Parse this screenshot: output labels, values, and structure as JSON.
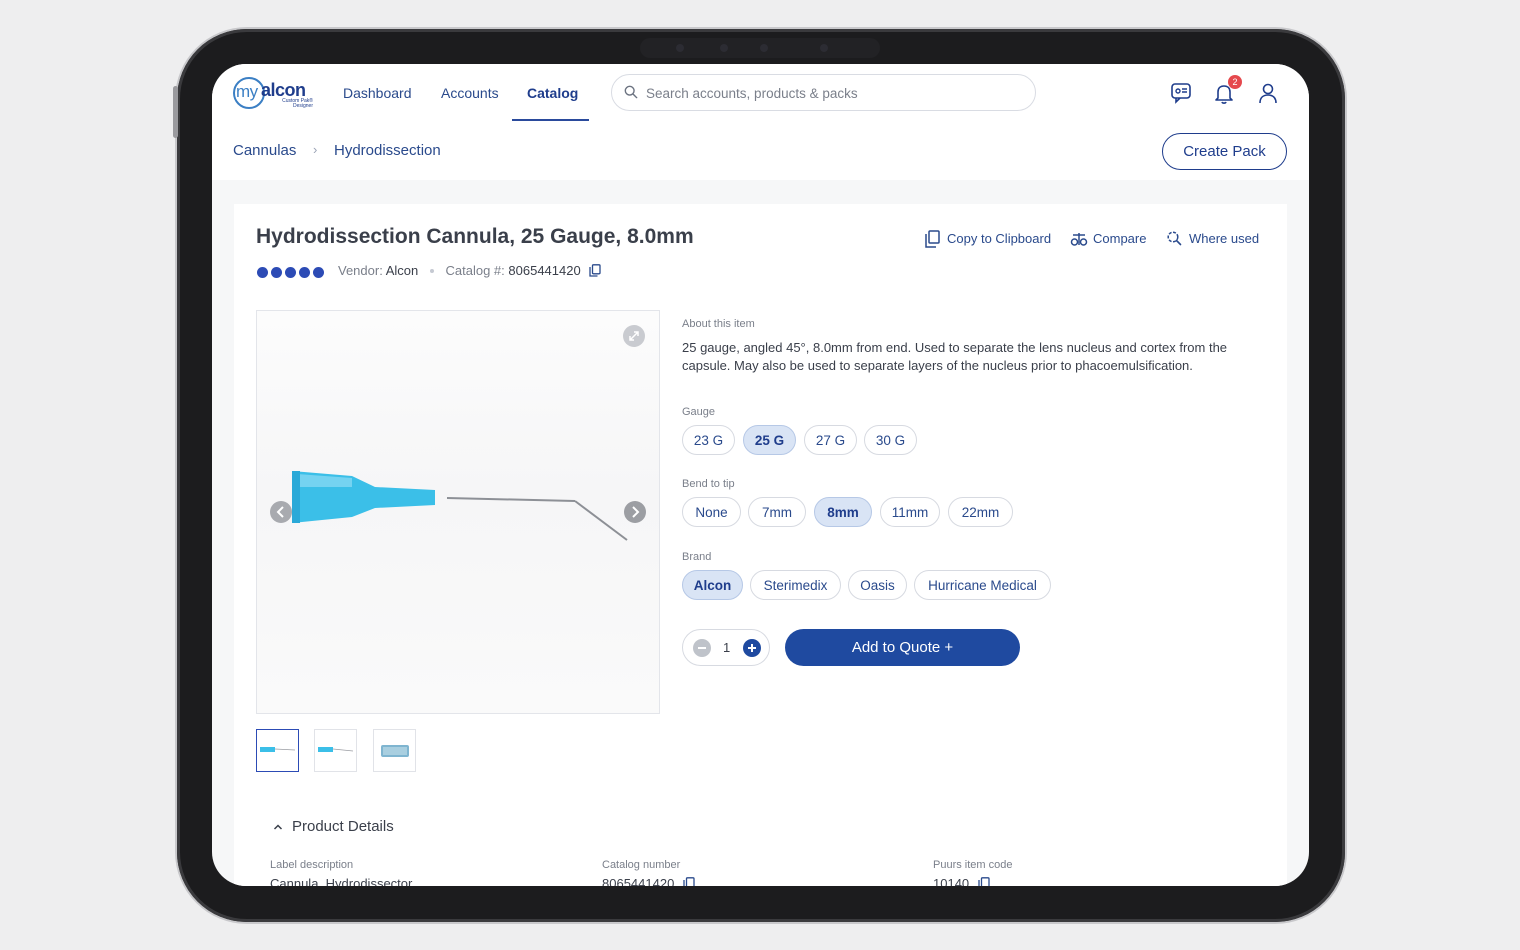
{
  "nav": {
    "logo_my": "my",
    "logo_alcon": "alcon",
    "logo_sub": "Custom Pak® Designer",
    "items": [
      "Dashboard",
      "Accounts",
      "Catalog"
    ],
    "active": "Catalog",
    "search_placeholder": "Search accounts, products & packs",
    "notification_count": "2"
  },
  "breadcrumb": [
    "Cannulas",
    "Hydrodissection"
  ],
  "breadcrumb_separator": "›",
  "create_pack_label": "Create Pack",
  "product": {
    "title": "Hydrodissection Cannula, 25 Gauge, 8.0mm",
    "rating_dots": 5,
    "vendor_label": "Vendor:",
    "vendor": "Alcon",
    "catalog_label": "Catalog #:",
    "catalog_number": "8065441420",
    "actions": [
      "Copy to Clipboard",
      "Compare",
      "Where used"
    ],
    "about_label": "About this item",
    "about_text": "25 gauge, angled 45°, 8.0mm from end. Used to separate the lens nucleus and cortex from the capsule. May also be used to separate layers of the nucleus prior to phacoemulsification."
  },
  "options": {
    "gauge": {
      "label": "Gauge",
      "values": [
        "23 G",
        "25 G",
        "27 G",
        "30 G"
      ],
      "selected": "25 G"
    },
    "bend": {
      "label": "Bend to tip",
      "values": [
        "None",
        "7mm",
        "8mm",
        "11mm",
        "22mm"
      ],
      "selected": "8mm"
    },
    "brand": {
      "label": "Brand",
      "values": [
        "Alcon",
        "Sterimedix",
        "Oasis",
        "Hurricane Medical"
      ],
      "selected": "Alcon"
    }
  },
  "quantity": "1",
  "add_to_quote_label": "Add to Quote +",
  "details": {
    "header": "Product Details",
    "columns": [
      {
        "label": "Label description",
        "value": "Cannula, Hydrodissector"
      },
      {
        "label": "Catalog number",
        "value": "8065441420"
      },
      {
        "label": "Puurs item code",
        "value": "10140"
      }
    ]
  },
  "colors": {
    "primary": "#1f4aa0",
    "accent": "#2c4bb5",
    "chip_selected": "#d9e4f5",
    "cannula_hub": "#3bbfe8"
  }
}
